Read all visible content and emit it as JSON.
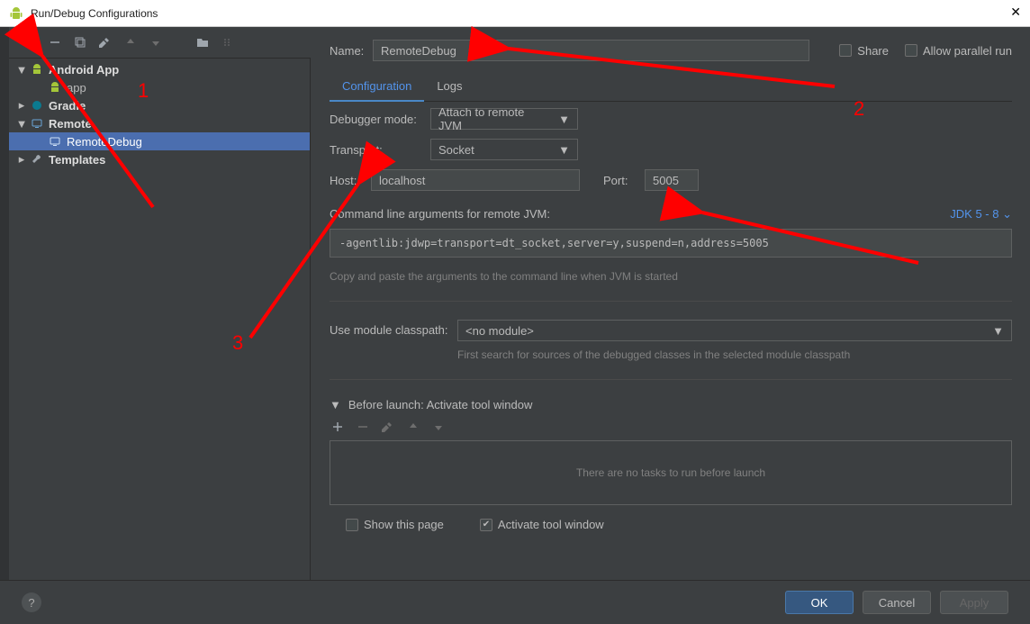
{
  "window": {
    "title": "Run/Debug Configurations"
  },
  "name": {
    "label": "Name:",
    "value": "RemoteDebug"
  },
  "share": {
    "label": "Share"
  },
  "parallel": {
    "label": "Allow parallel run"
  },
  "tree": {
    "android_app": "Android App",
    "app": "app",
    "gradle": "Gradle",
    "remote": "Remote",
    "remote_debug": "RemoteDebug",
    "templates": "Templates"
  },
  "tabs": {
    "configuration": "Configuration",
    "logs": "Logs"
  },
  "form": {
    "debugger_mode": {
      "label": "Debugger mode:",
      "value": "Attach to remote JVM"
    },
    "transport": {
      "label": "Transport:",
      "value": "Socket"
    },
    "host": {
      "label": "Host:",
      "value": "localhost"
    },
    "port": {
      "label": "Port:",
      "value": "5005"
    },
    "cmdline_label": "Command line arguments for remote JVM:",
    "jdk": "JDK 5 - 8",
    "cmdline": "-agentlib:jdwp=transport=dt_socket,server=y,suspend=n,address=5005",
    "cmdline_hint": "Copy and paste the arguments to the command line when JVM is started",
    "module_label": "Use module classpath:",
    "module_value": "<no module>",
    "module_hint": "First search for sources of the debugged classes in the selected module classpath"
  },
  "before": {
    "heading": "Before launch: Activate tool window",
    "empty": "There are no tasks to run before launch",
    "show_page": "Show this page",
    "activate_tool": "Activate tool window"
  },
  "footer": {
    "ok": "OK",
    "cancel": "Cancel",
    "apply": "Apply"
  },
  "annotations": {
    "a1": "1",
    "a2": "2",
    "a3": "3"
  }
}
